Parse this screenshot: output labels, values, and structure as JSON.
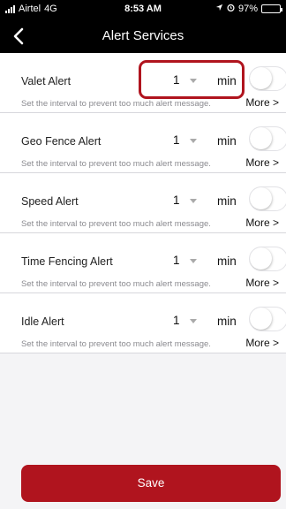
{
  "status_bar": {
    "carrier": "Airtel",
    "network": "4G",
    "time": "8:53 AM",
    "battery": "97%",
    "battery_level": 0.97
  },
  "nav": {
    "title": "Alert Services",
    "back_icon": "chevron-left-icon"
  },
  "alerts": [
    {
      "title": "Valet Alert",
      "interval": "1",
      "unit": "min",
      "enabled": false,
      "description": "Set the interval to prevent too much alert message.",
      "more": "More >"
    },
    {
      "title": "Geo Fence Alert",
      "interval": "1",
      "unit": "min",
      "enabled": false,
      "description": "Set the interval to prevent too much alert message.",
      "more": "More >"
    },
    {
      "title": "Speed Alert",
      "interval": "1",
      "unit": "min",
      "enabled": false,
      "description": "Set the interval to prevent too much alert message.",
      "more": "More >"
    },
    {
      "title": "Time Fencing Alert",
      "interval": "1",
      "unit": "min",
      "enabled": false,
      "description": "Set the interval to prevent too much alert message.",
      "more": "More >"
    },
    {
      "title": "Idle Alert",
      "interval": "1",
      "unit": "min",
      "enabled": false,
      "description": "Set the interval to prevent too much alert message.",
      "more": "More >"
    }
  ],
  "save_label": "Save",
  "colors": {
    "accent": "#b0141e",
    "background": "#f4f4f6",
    "header": "#000000"
  }
}
